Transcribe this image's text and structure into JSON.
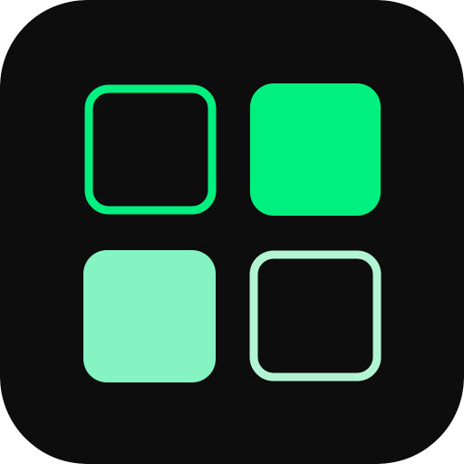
{
  "icon": {
    "name": "grid-apps-icon",
    "background_color": "#0d0d0d",
    "tiles": [
      {
        "name": "top-left-tile",
        "style": "outline",
        "color": "#00f07f"
      },
      {
        "name": "top-right-tile",
        "style": "filled",
        "color": "#00f07f"
      },
      {
        "name": "bottom-left-tile",
        "style": "filled",
        "color": "#86f3c3"
      },
      {
        "name": "bottom-right-tile",
        "style": "outline",
        "color": "#b2f4d4"
      }
    ]
  }
}
